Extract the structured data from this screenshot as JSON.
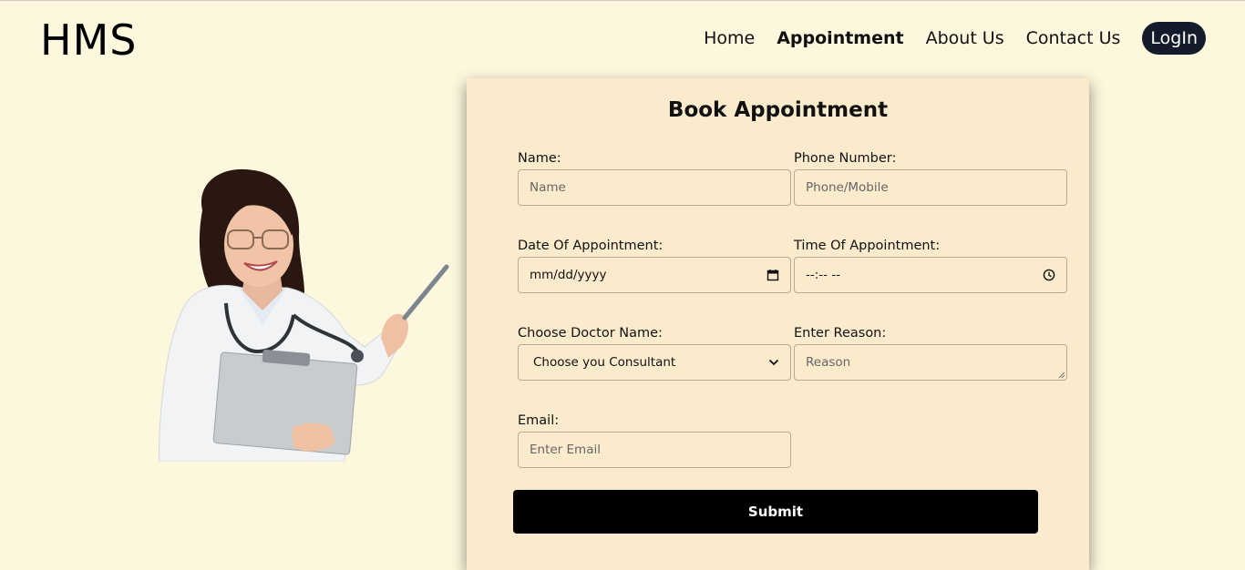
{
  "header": {
    "logo": "HMS",
    "nav": [
      {
        "label": "Home",
        "active": false
      },
      {
        "label": "Appointment",
        "active": true
      },
      {
        "label": "About Us",
        "active": false
      },
      {
        "label": "Contact Us",
        "active": false
      }
    ],
    "login_label": "LogIn"
  },
  "form": {
    "title": "Book Appointment",
    "name": {
      "label": "Name:",
      "placeholder": "Name"
    },
    "phone": {
      "label": "Phone Number:",
      "placeholder": "Phone/Mobile"
    },
    "date": {
      "label": "Date Of Appointment:",
      "value": "mm/dd/yyyy"
    },
    "time": {
      "label": "Time Of Appointment:",
      "value": "--:-- --"
    },
    "doctor": {
      "label": "Choose Doctor Name:",
      "selected": "Choose you Consultant"
    },
    "reason": {
      "label": "Enter Reason:",
      "placeholder": "Reason"
    },
    "email": {
      "label": "Email:",
      "placeholder": "Enter Email"
    },
    "submit_label": "Submit"
  },
  "icons": {
    "date": "calendar-icon",
    "time": "clock-icon",
    "select": "chevron-down-icon"
  },
  "colors": {
    "page_bg": "#fdf8dd",
    "card_bg": "#faebcc",
    "login_bg": "#141c2c",
    "submit_bg": "#000000"
  }
}
